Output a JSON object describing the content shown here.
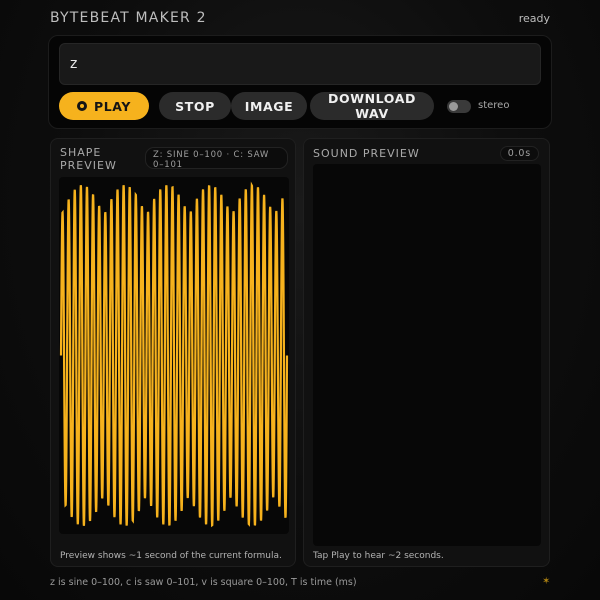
{
  "app": {
    "title": "BYTEBEAT MAKER 2",
    "status": "ready"
  },
  "editor": {
    "formula": "z"
  },
  "controls": {
    "play_label": "PLAY",
    "stop_label": "STOP",
    "image_label": "IMAGE",
    "download_label": "DOWNLOAD WAV",
    "stereo_label": "stereo",
    "stereo_on": false
  },
  "shape_preview": {
    "title": "SHAPE PREVIEW",
    "legend": "Z: SINE 0–100 · C: SAW 0–101",
    "caption": "Preview shows ~1 second of the current formula.",
    "wave_color": "#f6b21d"
  },
  "sound_preview": {
    "title": "SOUND PREVIEW",
    "time": "0.0s",
    "caption": "Tap Play to hear ~2 seconds."
  },
  "footer": {
    "note": "z is sine 0–100, c is saw 0–101, v is square 0–100, T is time (ms)"
  },
  "colors": {
    "accent": "#f6b21d",
    "background": "#0d0d0d",
    "button_dark": "#2b2b2b"
  },
  "icons": {
    "play": "play-circle-icon",
    "corner": "sparkle-icon"
  }
}
